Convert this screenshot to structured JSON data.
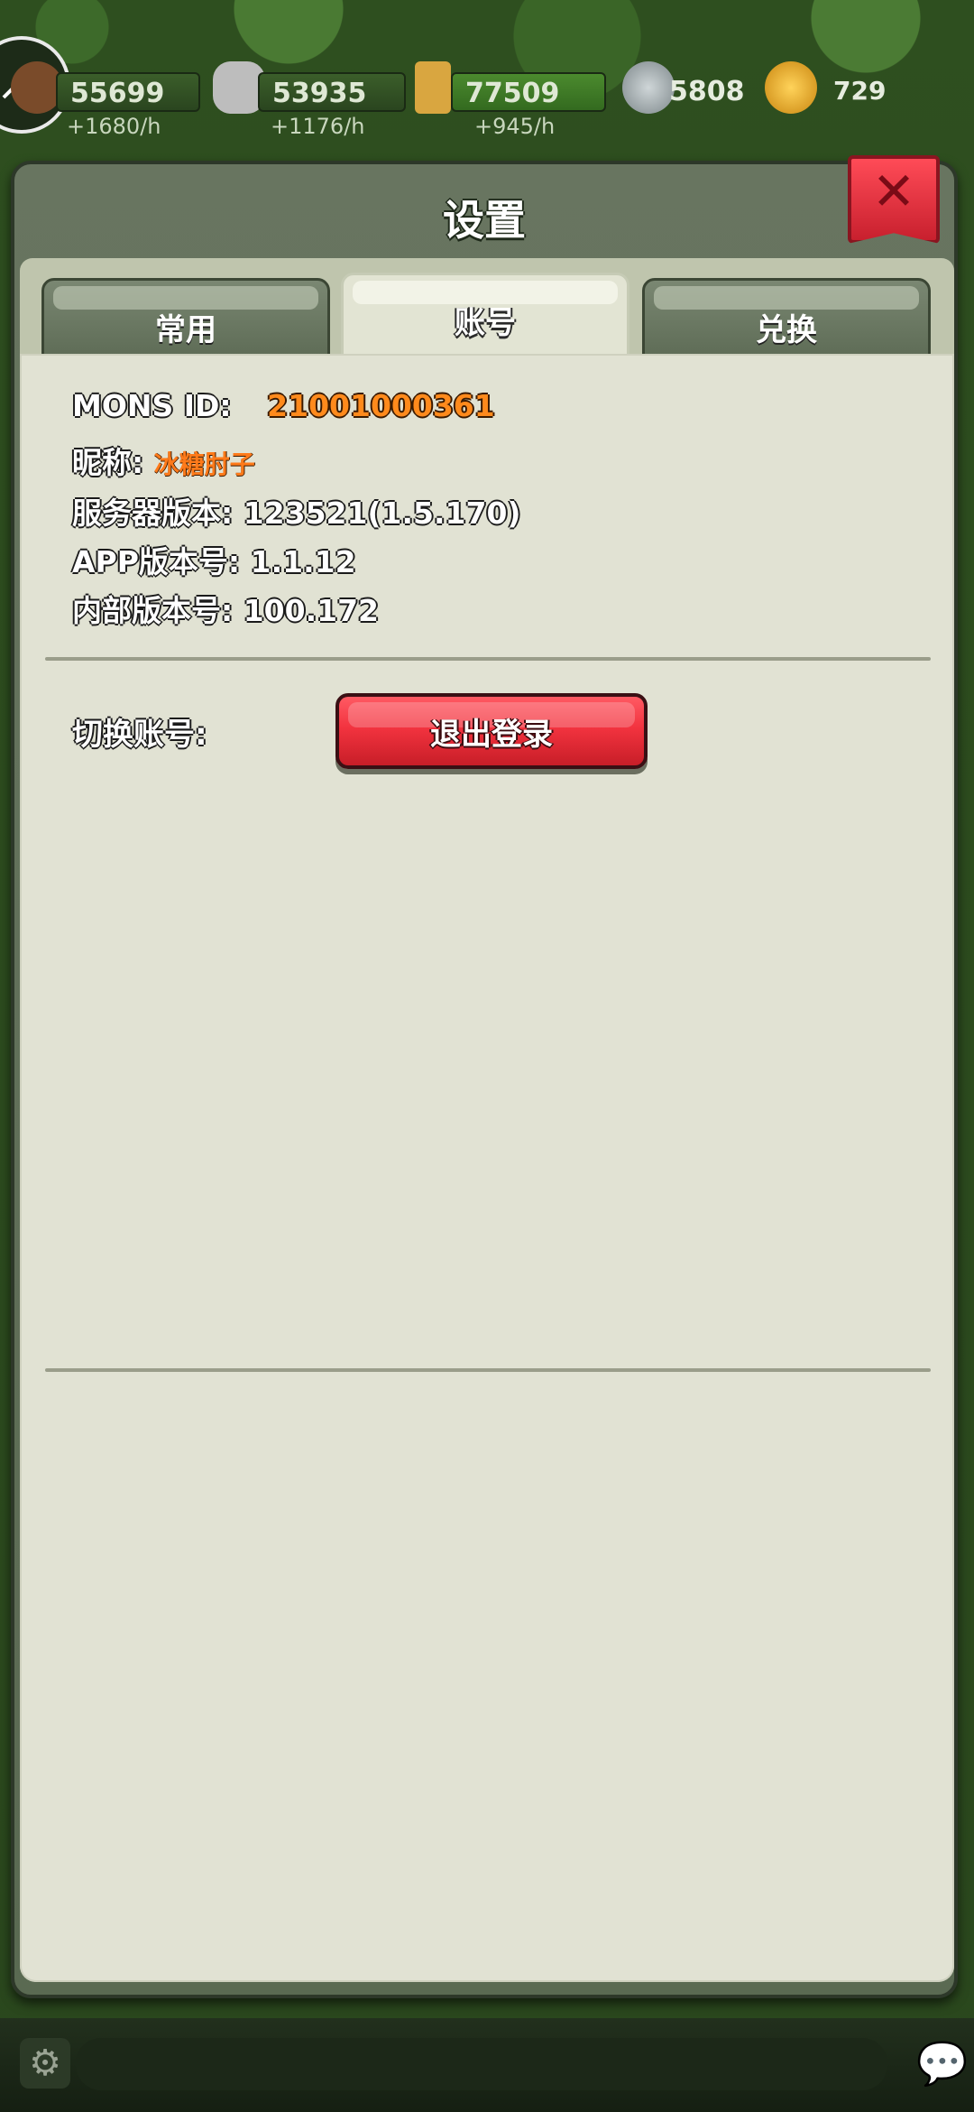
{
  "resources": [
    {
      "value": "55699",
      "rate": "+1680/h",
      "icon": "wood-icon",
      "color": "#7a4b2a"
    },
    {
      "value": "53935",
      "rate": "+1176/h",
      "icon": "stone-icon",
      "color": "#c8c8c8"
    },
    {
      "value": "77509",
      "rate": "+945/h",
      "icon": "wheat-icon",
      "color": "#d9a640"
    }
  ],
  "currency": [
    {
      "value": "5808",
      "icon": "silver-coin-icon",
      "color": "#9aa3a6"
    },
    {
      "value": "729",
      "icon": "gold-coin-icon",
      "color": "#e7a21d"
    }
  ],
  "modal": {
    "title": "设置",
    "close_icon": "close-icon"
  },
  "tabs": [
    {
      "label": "常用",
      "active": false
    },
    {
      "label": "账号",
      "active": true
    },
    {
      "label": "兑换",
      "active": false
    }
  ],
  "account": {
    "mons_id_label": "MONS ID:",
    "mons_id_value": "21001000361",
    "nickname_label": "昵称:",
    "nickname_value": "冰糖肘子",
    "server_version_label": "服务器版本:",
    "server_version_value": "123521(1.5.170)",
    "app_version_label": "APP版本号:",
    "app_version_value": "1.1.12",
    "internal_version_label": "内部版本号:",
    "internal_version_value": "100.172",
    "switch_account_label": "切换账号:",
    "logout_button": "退出登录"
  },
  "bottom": {
    "settings_icon": "settings-icon",
    "chat_icon": "chat-icon"
  }
}
